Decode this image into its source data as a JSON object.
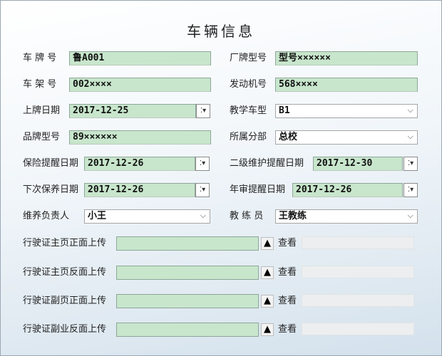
{
  "title": "车辆信息",
  "fields": {
    "plate_label": "车 牌 号",
    "plate_value": "鲁A001",
    "factory_model_label": "厂牌型号",
    "factory_model_value": "型号××××××",
    "frame_label": "车 架 号",
    "frame_value": "002××××",
    "engine_label": "发动机号",
    "engine_value": "568××××",
    "reg_date_label": "上牌日期",
    "reg_date_value": "2017-12-25",
    "teach_type_label": "教学车型",
    "teach_type_value": "B1",
    "brand_model_label": "品牌型号",
    "brand_model_value": "89××××××",
    "branch_label": "所属分部",
    "branch_value": "总校",
    "insurance_label": "保险提醒日期",
    "insurance_value": "2017-12-26",
    "level2_label": "二级维护提醒日期",
    "level2_value": "2017-12-30",
    "next_maint_label": "下次保养日期",
    "next_maint_value": "2017-12-26",
    "annual_label": "年审提醒日期",
    "annual_value": "2017-12-26",
    "maint_person_label": "维养负责人",
    "maint_person_value": "小王",
    "coach_label": "教 练 员",
    "coach_value": "王教练"
  },
  "uploads": [
    {
      "label": "行驶证主页正面上传",
      "view": "查看"
    },
    {
      "label": "行驶证主页反面上传",
      "view": "查看"
    },
    {
      "label": "行驶证副页正面上传",
      "view": "查看"
    },
    {
      "label": "行驶证副业反面上传",
      "view": "查看"
    }
  ],
  "icons": {
    "chevron": "chevron-down-icon",
    "spin": "spin-arrows-icon",
    "upload": "upload-triangle-icon"
  }
}
